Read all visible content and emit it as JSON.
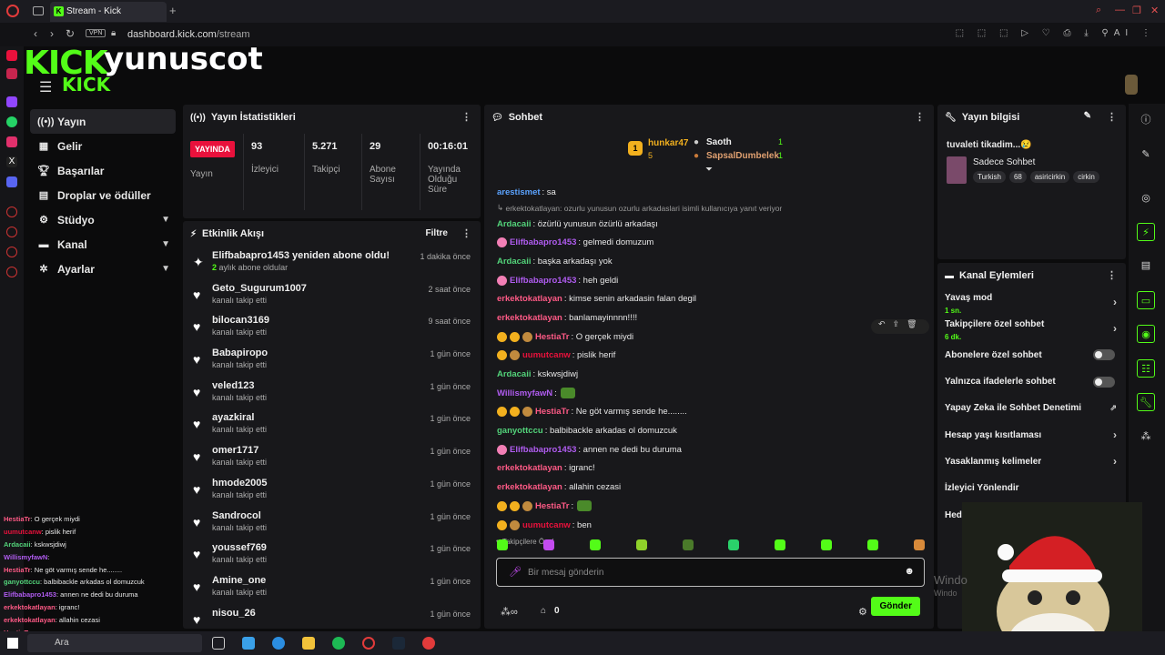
{
  "browser": {
    "tab_title": "Stream - Kick Dashboard",
    "vpn": "VPN",
    "url_domain": "dashboard.kick.com",
    "url_path": "/stream",
    "ai_label": "AI"
  },
  "brand": {
    "logo": "KICK",
    "logo_small": "KICK",
    "beta": "BETA",
    "channel_name": "yunuscot"
  },
  "sidebar": {
    "items": [
      {
        "label": "Yayın",
        "icon": "broadcast-icon",
        "active": true
      },
      {
        "label": "Gelir",
        "icon": "money-icon"
      },
      {
        "label": "Başarılar",
        "icon": "trophy-icon"
      },
      {
        "label": "Droplar ve ödüller",
        "icon": "gift-icon"
      },
      {
        "label": "Stüdyo",
        "icon": "gear-icon",
        "expandable": true
      },
      {
        "label": "Kanal",
        "icon": "channel-icon",
        "expandable": true
      },
      {
        "label": "Ayarlar",
        "icon": "settings-icon",
        "expandable": true
      }
    ]
  },
  "stats_panel": {
    "title": "Yayın İstatistikleri",
    "live_badge": "YAYINDA",
    "live_label": "Yayın",
    "items": [
      {
        "value": "93",
        "label": "İzleyici"
      },
      {
        "value": "5.271",
        "label": "Takipçi"
      },
      {
        "value": "29",
        "label": "Abone Sayısı"
      },
      {
        "value": "00:16:01",
        "label": "Yayında Olduğu Süre"
      }
    ]
  },
  "activity": {
    "title": "Etkinlik Akışı",
    "filter": "Filtre",
    "items": [
      {
        "name": "Elifbabapro1453 yeniden abone oldu!",
        "sub_prefix": "2",
        "sub": " aylık abone oldular",
        "time": "1 dakika önce",
        "icon": "sparkle-icon"
      },
      {
        "name": "Geto_Sugurum1007",
        "sub": "kanalı takip etti",
        "time": "2 saat önce"
      },
      {
        "name": "bilocan3169",
        "sub": "kanalı takip etti",
        "time": "9 saat önce"
      },
      {
        "name": "Babapiropo",
        "sub": "kanalı takip etti",
        "time": "1 gün önce"
      },
      {
        "name": "veled123",
        "sub": "kanalı takip etti",
        "time": "1 gün önce"
      },
      {
        "name": "ayazkiral",
        "sub": "kanalı takip etti",
        "time": "1 gün önce"
      },
      {
        "name": "omer1717",
        "sub": "kanalı takip etti",
        "time": "1 gün önce"
      },
      {
        "name": "hmode2005",
        "sub": "kanalı takip etti",
        "time": "1 gün önce"
      },
      {
        "name": "Sandrocol",
        "sub": "kanalı takip etti",
        "time": "1 gün önce"
      },
      {
        "name": "youssef769",
        "sub": "kanalı takip etti",
        "time": "1 gün önce"
      },
      {
        "name": "Amine_one",
        "sub": "kanalı takip etti",
        "time": "1 gün önce"
      },
      {
        "name": "nisou_26",
        "sub": "",
        "time": "1 gün önce"
      }
    ]
  },
  "chat": {
    "title": "Sohbet",
    "leaderboard": [
      {
        "rank": "1",
        "name": "hunkar47",
        "count": "5"
      },
      {
        "name": "Saoth",
        "count": "1"
      },
      {
        "name": "SapsalDumbelek",
        "count": "1"
      }
    ],
    "messages": [
      {
        "user": "arestismet",
        "color": "#5ba3ff",
        "text": ": sa",
        "badges": []
      },
      {
        "reply": "erkektokatlayan: ozurlu yunusun ozurlu arkadaslari isimli kullanıcıya yanıt veriyor"
      },
      {
        "user": "Ardacaii",
        "color": "#53d37a",
        "text": ": özürlü yunusun özürlü arkadaşı",
        "badges": []
      },
      {
        "user": "Elifbabapro1453",
        "color": "#b05cf0",
        "text": ": gelmedi domuzum",
        "badges": [
          "#f27fb5"
        ]
      },
      {
        "user": "Ardacaii",
        "color": "#53d37a",
        "text": ": başka arkadaşı yok",
        "badges": []
      },
      {
        "user": "Elifbabapro1453",
        "color": "#b05cf0",
        "text": ": heh geldi",
        "badges": [
          "#f27fb5"
        ]
      },
      {
        "user": "erkektokatlayan",
        "color": "#ff5a86",
        "text": ": kimse senin arkadasin falan degil",
        "badges": []
      },
      {
        "user": "erkektokatlayan",
        "color": "#ff5a86",
        "text": ": banlamayinnnn!!!!",
        "badges": []
      },
      {
        "user": "HestiaTr",
        "color": "#ff5a86",
        "text": ": O gerçek miydi",
        "badges": [
          "#f2b01e",
          "#f2b01e",
          "#c08a3e"
        ]
      },
      {
        "user": "uumutcanw",
        "color": "#e9113c",
        "text": ": pislik herif",
        "badges": [
          "#f2b01e",
          "#c08a3e"
        ]
      },
      {
        "user": "Ardacaii",
        "color": "#53d37a",
        "text": ": kskwsjdiwj",
        "badges": []
      },
      {
        "user": "WillismyfawN",
        "color": "#b05cf0",
        "text": ":",
        "badges": [],
        "emote": true
      },
      {
        "user": "HestiaTr",
        "color": "#ff5a86",
        "text": ": Ne göt varmış sende he........",
        "badges": [
          "#f2b01e",
          "#f2b01e",
          "#c08a3e"
        ]
      },
      {
        "user": "ganyottccu",
        "color": "#53d37a",
        "text": ": balbibackle arkadas ol domuzcuk",
        "badges": []
      },
      {
        "user": "Elifbabapro1453",
        "color": "#b05cf0",
        "text": ": annen ne dedi bu duruma",
        "badges": [
          "#f27fb5"
        ]
      },
      {
        "user": "erkektokatlayan",
        "color": "#ff5a86",
        "text": ": igranc!",
        "badges": []
      },
      {
        "user": "erkektokatlayan",
        "color": "#ff5a86",
        "text": ": allahin cezasi",
        "badges": []
      },
      {
        "user": "HestiaTr",
        "color": "#ff5a86",
        "text": ":",
        "badges": [
          "#f2b01e",
          "#f2b01e",
          "#c08a3e"
        ],
        "emote": true
      },
      {
        "user": "uumutcanw",
        "color": "#e9113c",
        "text": ": ben",
        "badges": [
          "#f2b01e",
          "#c08a3e"
        ]
      }
    ],
    "followers_only": "Takipçilere Özel",
    "input_placeholder": "Bir mesaj gönderin",
    "points": "0",
    "send": "Gönder"
  },
  "stream_info": {
    "title": "Yayın bilgisi",
    "stream_title": "tuvaleti tikadim...😢",
    "category": "Sadece Sohbet",
    "tags": [
      "Turkish",
      "68",
      "asiricirkin",
      "cirkin"
    ]
  },
  "channel_actions": {
    "title": "Kanal Eylemleri",
    "items": [
      {
        "label": "Yavaş mod",
        "sub": "1 sn.",
        "type": "chevron"
      },
      {
        "label": "Takipçilere özel sohbet",
        "sub": "6 dk.",
        "type": "chevron"
      },
      {
        "label": "Abonelere özel sohbet",
        "type": "toggle"
      },
      {
        "label": "Yalnızca ifadelerle sohbet",
        "type": "toggle"
      },
      {
        "label": "Yapay Zeka ile Sohbet Denetimi",
        "type": "external"
      },
      {
        "label": "Hesap yaşı kısıtlaması",
        "type": "chevron"
      },
      {
        "label": "Yasaklanmış kelimeler",
        "type": "chevron"
      },
      {
        "label": "İzleyici Yönlendir",
        "type": "none"
      },
      {
        "label": "Hed",
        "type": "none"
      }
    ]
  },
  "overlay_chat": [
    {
      "u": "HestiaTr",
      "c": "#ff5a86",
      "t": ": O gerçek miydi"
    },
    {
      "u": "uumutcanw",
      "c": "#e9113c",
      "t": ": pislik herif"
    },
    {
      "u": "Ardacaii",
      "c": "#53d37a",
      "t": ": kskwsjdiwj"
    },
    {
      "u": "WillismyfawN",
      "c": "#b05cf0",
      "t": ":"
    },
    {
      "u": "HestiaTr",
      "c": "#ff5a86",
      "t": ": Ne göt varmış sende he........"
    },
    {
      "u": "ganyottccu",
      "c": "#53d37a",
      "t": ": balbibackle arkadas ol domuzcuk"
    },
    {
      "u": "Elifbabapro1453",
      "c": "#b05cf0",
      "t": ": annen ne dedi bu duruma"
    },
    {
      "u": "erkektokatlayan",
      "c": "#ff5a86",
      "t": ": igranc!"
    },
    {
      "u": "erkektokatlayan",
      "c": "#ff5a86",
      "t": ": allahin cezasi"
    },
    {
      "u": "HestiaTr",
      "c": "#ff5a86",
      "t": ":"
    },
    {
      "u": "uumutcanw",
      "c": "#e9113c",
      "t": ": ben"
    }
  ],
  "taskbar": {
    "search": "Ara"
  },
  "watermark": {
    "line1": "Windo",
    "line2": "Windo"
  }
}
